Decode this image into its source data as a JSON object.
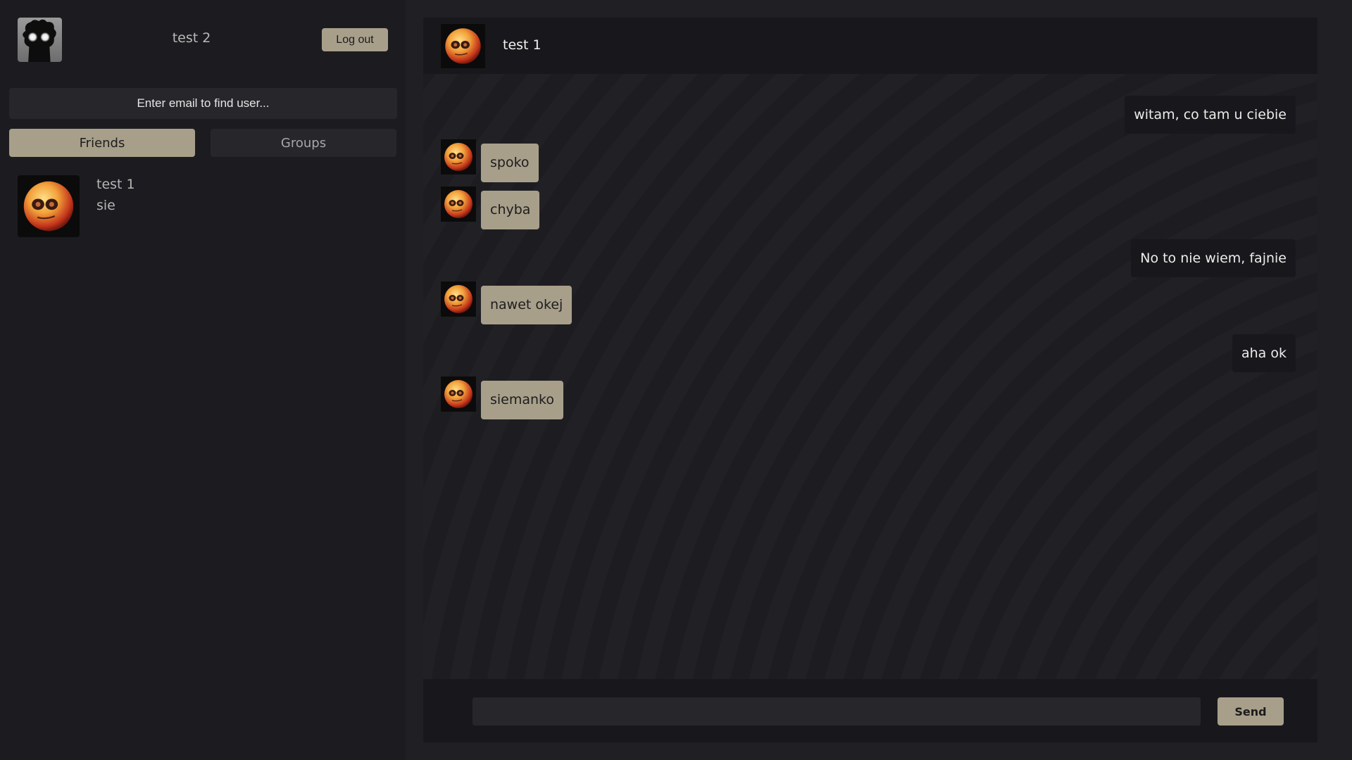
{
  "colors": {
    "accent": "#a89f8b",
    "sidebar_bg": "#1c1c20",
    "panel_bg": "#18181c",
    "input_bg": "#26262b"
  },
  "sidebar": {
    "current_user": {
      "name": "test 2",
      "avatar_icon": "shadow-figure-glowing-eyes-avatar"
    },
    "logout_label": "Log out",
    "search": {
      "placeholder": "Enter email to find user...",
      "value": ""
    },
    "tabs": [
      {
        "label": "Friends",
        "active": true
      },
      {
        "label": "Groups",
        "active": false
      }
    ],
    "friends": [
      {
        "name": "test 1",
        "preview": "sie",
        "avatar_icon": "orange-smiley-ball-avatar"
      }
    ]
  },
  "chat": {
    "title": "test 1",
    "avatar_icon": "orange-smiley-ball-avatar",
    "messages": [
      {
        "direction": "outgoing",
        "text": "witam, co tam u ciebie"
      },
      {
        "direction": "incoming",
        "text": "spoko"
      },
      {
        "direction": "incoming",
        "text": "chyba"
      },
      {
        "direction": "outgoing",
        "text": "No to nie wiem, fajnie"
      },
      {
        "direction": "incoming",
        "text": "nawet okej"
      },
      {
        "direction": "outgoing",
        "text": "aha ok"
      },
      {
        "direction": "incoming",
        "text": "siemanko"
      }
    ],
    "composer": {
      "placeholder": "",
      "value": ""
    },
    "send_label": "Send"
  }
}
